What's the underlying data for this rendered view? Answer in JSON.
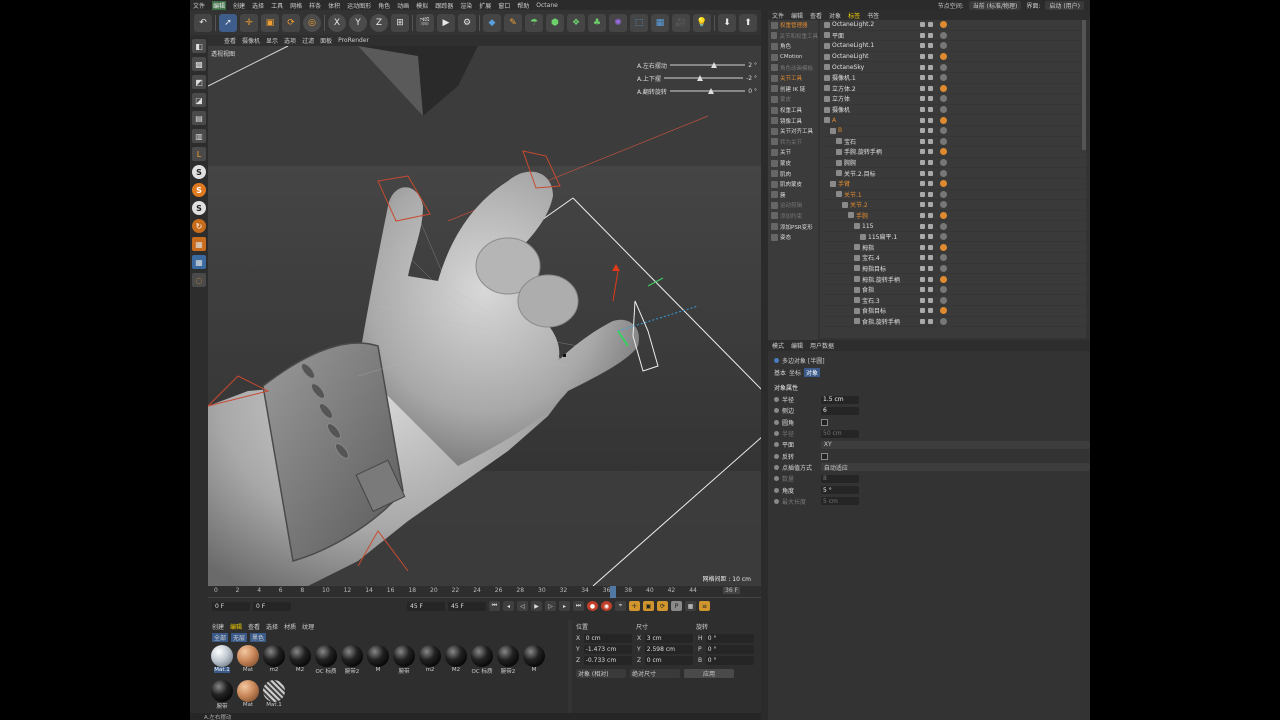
{
  "menu": {
    "items": [
      "文件",
      "编辑",
      "创建",
      "选择",
      "工具",
      "网格",
      "样条",
      "体积",
      "运动图形",
      "角色",
      "动画",
      "模拟",
      "跟踪器",
      "渲染",
      "扩展",
      "窗口",
      "帮助",
      "Octane"
    ],
    "active": "编辑",
    "node_space_label": "节点空间:",
    "node_space_value": "当前 (标准/物理)",
    "interface_label": "界面:",
    "interface_value": "启动 (用户)"
  },
  "toolbar": {
    "icons": [
      "undo-icon",
      "move-icon",
      "scale-icon",
      "rotate-icon",
      "rotate-icon",
      "x-axis-icon",
      "y-axis-icon",
      "z-axis-icon",
      "coord-icon",
      "render-region-icon",
      "render-view-icon",
      "render-settings-icon",
      "cube-icon",
      "pen-icon",
      "select-icon",
      "subdivision-icon",
      "cloner-icon",
      "deformer-icon",
      "scene-icon",
      "camera-icon",
      "light-icon",
      "download-icon",
      "upload-icon",
      "settings-icon"
    ],
    "axis_x": "X",
    "axis_y": "Y",
    "axis_z": "Z"
  },
  "viewport": {
    "menu": [
      "查看",
      "摄像机",
      "显示",
      "选项",
      "过滤",
      "面板",
      "ProRender"
    ],
    "label": "透视视图",
    "grid_info": "网格间距 : 10 cm",
    "sliders": [
      {
        "label": "A.左右摆动",
        "value": "2 °",
        "level": 0.55
      },
      {
        "label": "A.上下摆",
        "value": "-2 °",
        "level": 0.42
      },
      {
        "label": "A.翻转旋转",
        "value": "0 °",
        "level": 0.5
      }
    ]
  },
  "timeline": {
    "ticks": [
      "0",
      "2",
      "4",
      "6",
      "8",
      "10",
      "12",
      "14",
      "16",
      "18",
      "20",
      "22",
      "24",
      "26",
      "28",
      "30",
      "32",
      "34",
      "36",
      "38",
      "40",
      "42",
      "44"
    ],
    "current_frame": "36 F",
    "start": "0 F",
    "start2": "0 F",
    "end": "45 F",
    "end2": "45 F"
  },
  "materials": {
    "tabs": [
      "创建",
      "编辑",
      "查看",
      "选择",
      "材质",
      "纹理"
    ],
    "active_tab": "编辑",
    "filter_tabs": [
      "全部",
      "无层",
      "黑色"
    ],
    "items": [
      {
        "label": "Mat.1",
        "style": "white",
        "selected": true
      },
      {
        "label": "Mat",
        "style": "orange"
      },
      {
        "label": "m2",
        "style": "black"
      },
      {
        "label": "M2",
        "style": "black"
      },
      {
        "label": "OC 标质",
        "style": "black"
      },
      {
        "label": "腕带2",
        "style": "black"
      },
      {
        "label": "M",
        "style": "black"
      },
      {
        "label": "腕带",
        "style": "black"
      },
      {
        "label": "m2",
        "style": "black"
      },
      {
        "label": "M2",
        "style": "black"
      },
      {
        "label": "OC 标质",
        "style": "black"
      },
      {
        "label": "腕带2",
        "style": "black"
      },
      {
        "label": "M",
        "style": "black"
      },
      {
        "label": "腕带",
        "style": "black"
      },
      {
        "label": "Mat",
        "style": "orange"
      },
      {
        "label": "Mat.1",
        "style": "check"
      }
    ]
  },
  "coords": {
    "headers": [
      "位置",
      "尺寸",
      "旋转"
    ],
    "rows": [
      {
        "axis": "X",
        "pos": "0 cm",
        "size_axis": "X",
        "size": "3 cm",
        "rot_axis": "H",
        "rot": "0 °"
      },
      {
        "axis": "Y",
        "pos": "-1.473 cm",
        "size_axis": "Y",
        "size": "2.598 cm",
        "rot_axis": "P",
        "rot": "0 °"
      },
      {
        "axis": "Z",
        "pos": "-0.733 cm",
        "size_axis": "Z",
        "size": "0 cm",
        "rot_axis": "B",
        "rot": "0 °"
      }
    ],
    "mode": "对象 (相对)",
    "size_mode": "绝对尺寸",
    "apply": "应用"
  },
  "status": "A.左右摆动",
  "object_manager": {
    "tabs": [
      "文件",
      "编辑",
      "查看",
      "对象",
      "标签",
      "书签"
    ],
    "left_list": [
      {
        "label": "权重管理器",
        "style": "orange"
      },
      {
        "label": "关节和权重工具",
        "style": "dim"
      },
      {
        "label": "角色",
        "style": "normal"
      },
      {
        "label": "CMotion",
        "style": "normal"
      },
      {
        "label": "角色动画模板",
        "style": "dim"
      },
      {
        "label": "关节工具",
        "style": "orange"
      },
      {
        "label": "创建 IK 链",
        "style": "normal"
      },
      {
        "label": "蒙皮",
        "style": "dim"
      },
      {
        "label": "权重工具",
        "style": "normal"
      },
      {
        "label": "镜像工具",
        "style": "normal"
      },
      {
        "label": "关节对齐工具",
        "style": "normal"
      },
      {
        "label": "转为关节",
        "style": "dim"
      },
      {
        "label": "关节",
        "style": "normal"
      },
      {
        "label": "蒙皮",
        "style": "normal"
      },
      {
        "label": "肌肉",
        "style": "normal"
      },
      {
        "label": "肌肉蒙皮",
        "style": "normal"
      },
      {
        "label": "簇",
        "style": "normal"
      },
      {
        "label": "运动剪辑",
        "style": "dim"
      },
      {
        "label": "添加约束",
        "style": "dim"
      },
      {
        "label": "添加PSR变形",
        "style": "normal"
      },
      {
        "label": "姿态",
        "style": "normal"
      }
    ],
    "objects": [
      {
        "name": "OctaneLight.2",
        "indent": 0
      },
      {
        "name": "平面",
        "indent": 0
      },
      {
        "name": "OctaneLight.1",
        "indent": 0
      },
      {
        "name": "OctaneLight",
        "indent": 0
      },
      {
        "name": "OctaneSky",
        "indent": 0
      },
      {
        "name": "摄像机.1",
        "indent": 0
      },
      {
        "name": "立方体.2",
        "indent": 0
      },
      {
        "name": "立方体",
        "indent": 0
      },
      {
        "name": "摄像机",
        "indent": 0
      },
      {
        "name": "A",
        "indent": 0,
        "highlight": true
      },
      {
        "name": "B",
        "indent": 1,
        "highlight": true
      },
      {
        "name": "宝石",
        "indent": 2
      },
      {
        "name": "手腕.旋转手柄",
        "indent": 2
      },
      {
        "name": "腕腕",
        "indent": 2
      },
      {
        "name": "关节.2.目标",
        "indent": 2
      },
      {
        "name": "手臂",
        "indent": 1,
        "highlight": true
      },
      {
        "name": "关节.1",
        "indent": 2,
        "highlight": true
      },
      {
        "name": "关节.2",
        "indent": 3,
        "highlight": true
      },
      {
        "name": "手腕",
        "indent": 4,
        "highlight": true
      },
      {
        "name": "115",
        "indent": 5
      },
      {
        "name": "115扁平.1",
        "indent": 6
      },
      {
        "name": "拇指",
        "indent": 5
      },
      {
        "name": "宝石.4",
        "indent": 5
      },
      {
        "name": "拇指目标",
        "indent": 5
      },
      {
        "name": "拇指.旋转手柄",
        "indent": 5
      },
      {
        "name": "食指",
        "indent": 5
      },
      {
        "name": "宝石.3",
        "indent": 5
      },
      {
        "name": "食指目标",
        "indent": 5
      },
      {
        "name": "食指.旋转手柄",
        "indent": 5
      }
    ]
  },
  "attributes": {
    "tabs": [
      "模式",
      "编辑",
      "用户数据"
    ],
    "title": "多边对象 [半圆]",
    "subtabs": [
      "基本",
      "坐标",
      "对象"
    ],
    "active_subtab": "对象",
    "section": "对象属性",
    "rows": [
      {
        "label": "半径",
        "value": "1.5 cm",
        "type": "num"
      },
      {
        "label": "侧边",
        "value": "6",
        "type": "num"
      },
      {
        "label": "圆角",
        "value": "",
        "type": "check"
      },
      {
        "label": "半径",
        "value": "50 cm",
        "type": "num",
        "disabled": true
      },
      {
        "label": "平面",
        "value": "XY",
        "type": "dropdown"
      },
      {
        "label": "反转",
        "value": "",
        "type": "check"
      },
      {
        "label": "点插值方式",
        "value": "自动适应",
        "type": "dropdown"
      },
      {
        "label": "数量",
        "value": "8",
        "type": "num",
        "disabled": true
      },
      {
        "label": "角度",
        "value": "5 °",
        "type": "num"
      },
      {
        "label": "最大长度",
        "value": "5 cm",
        "type": "num",
        "disabled": true
      }
    ]
  }
}
